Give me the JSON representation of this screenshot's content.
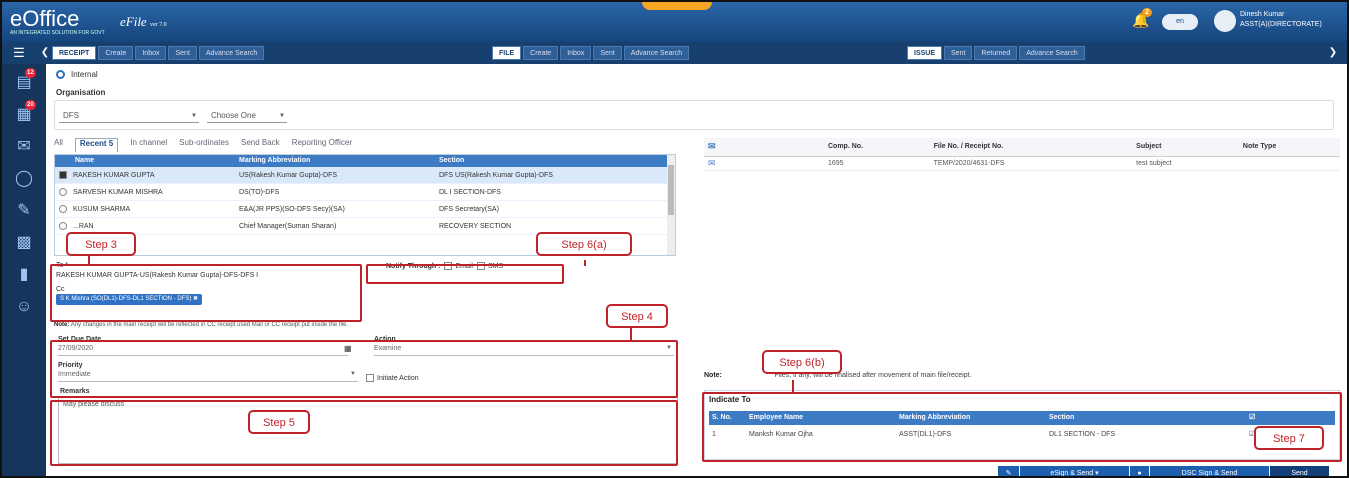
{
  "header": {
    "logo": "eOffice",
    "logo_sub": "AN INTEGRATED SOLUTION FOR GOVT",
    "efile": "eFile",
    "efile_version": "ver 7.0",
    "notification_count": "2",
    "toggle_label": "en",
    "user_name": "Dinesh Kumar",
    "user_designation": "ASST(A)(DIRECTORATE)"
  },
  "nav": {
    "receipt": {
      "head": "RECEIPT",
      "items": [
        "Create",
        "Inbox",
        "Sent",
        "Advance Search"
      ]
    },
    "file": {
      "head": "FILE",
      "items": [
        "Create",
        "Inbox",
        "Sent",
        "Advance Search"
      ]
    },
    "issue": {
      "head": "ISSUE",
      "items": [
        "Sent",
        "Returned",
        "Advance Search"
      ]
    }
  },
  "sidebar_badges": [
    "12",
    "20"
  ],
  "form": {
    "radio_internal": "Internal",
    "organisation_label": "Organisation",
    "org_value": "DFS",
    "org_choose": "Choose One",
    "tabs": [
      "All",
      "Recent 5",
      "In channel",
      "Sub-ordinates",
      "Send Back",
      "Reporting Officer"
    ],
    "grid_headers": [
      "Name",
      "Marking Abbreviation",
      "Section"
    ],
    "grid_rows": [
      {
        "name": "RAKESH KUMAR GUPTA",
        "abbr": "US(Rakesh Kumar Gupta)-DFS",
        "section": "DFS US(Rakesh Kumar Gupta)-DFS"
      },
      {
        "name": "SARVESH KUMAR MISHRA",
        "abbr": "DS(TO)-DFS",
        "section": "DL I SECTION-DFS"
      },
      {
        "name": "KUSUM SHARMA",
        "abbr": "E&A(JR PPS)(SO-DFS Secy)(SA)",
        "section": "DFS Secretary(SA)"
      },
      {
        "name": "...RAN",
        "abbr": "Chief Manager(Suman Sharan)",
        "section": "RECOVERY SECTION"
      }
    ],
    "to_label": "To *",
    "to_value": "RAKESH KUMAR GUPTA-US(Rakesh Kumar Gupta)-DFS-DFS I",
    "cc_label": "Cc",
    "cc_chip": "S K Mishra (SO(DL1)-DFS-DL1 SECTION - DFS) ✖",
    "notify_label": "Notify Through :",
    "notify_email": "Email",
    "notify_sms": "SMS",
    "note_label": "Note:",
    "note_text": "Any changes in the main receipt will be reflected in CC receipt used Mail or CC receipt put inside the file.",
    "due_date_label": "Set Due Date",
    "due_date_value": "27/09/2020",
    "action_label": "Action",
    "action_value": "Examine",
    "priority_label": "Priority",
    "priority_value": "Immediate",
    "initiate_label": "Initiate Action",
    "remarks_label": "Remarks",
    "remarks_value": "May please discuss"
  },
  "right": {
    "headers": [
      "",
      "Comp. No.",
      "File No. / Receipt No.",
      "Subject",
      "Note Type"
    ],
    "rows": [
      [
        "✉",
        "1695",
        "TEMP/2020/4631-DFS",
        "test subject",
        ""
      ]
    ],
    "note_label": "Note:",
    "note_text": "Files, if any, will be finalised after movement of main file/receipt.",
    "indicate_to": "Indicate To",
    "ind_headers": [
      "S. No.",
      "Employee Name",
      "Marking Abbreviation",
      "Section",
      "☑"
    ],
    "ind_rows": [
      [
        "1",
        "Manksh Kumar Ojha",
        "ASST(DL1)-DFS",
        "DL1 SECTION - DFS",
        "☑"
      ]
    ]
  },
  "buttons": {
    "esign": "eSign & Send ▾",
    "dsc": "DSC Sign & Send",
    "send": "Send"
  },
  "steps": {
    "s3": "Step 3",
    "s4": "Step 4",
    "s5": "Step 5",
    "s6a": "Step 6(a)",
    "s6b": "Step 6(b)",
    "s7": "Step 7"
  },
  "colors": {
    "topbar": "#1d528f",
    "nav": "#17406f",
    "accent": "#3d7bc4",
    "annotation": "#c0222a"
  }
}
